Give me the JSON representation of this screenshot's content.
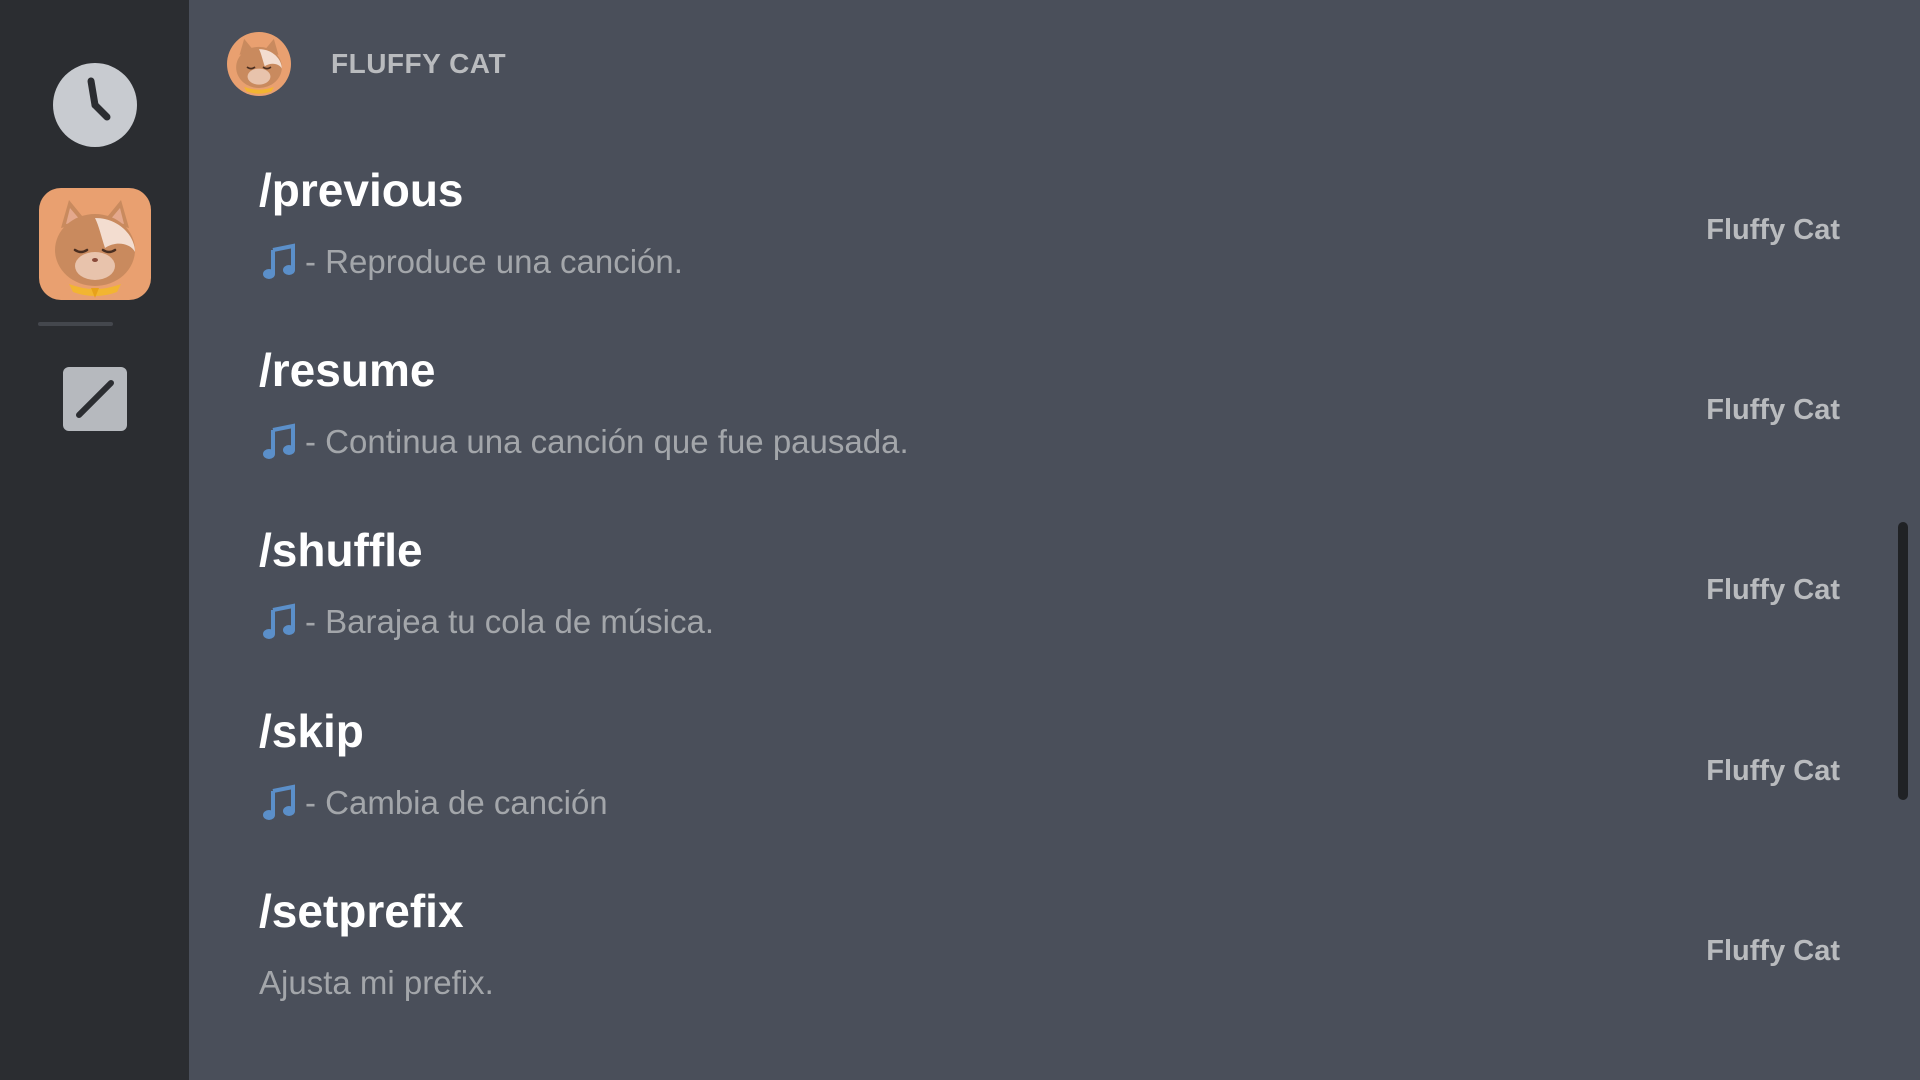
{
  "sidebar": {
    "items": [
      {
        "name": "recent",
        "icon": "clock-icon"
      },
      {
        "name": "bot",
        "icon": "fluffy-cat-avatar"
      },
      {
        "name": "built-in",
        "icon": "slash-icon"
      }
    ]
  },
  "section": {
    "title": "FLUFFY CAT"
  },
  "commands": [
    {
      "name": "/previous",
      "icon": "music-note-icon",
      "description": "- Reproduce una canción.",
      "source": "Fluffy Cat"
    },
    {
      "name": "/resume",
      "icon": "music-note-icon",
      "description": "- Continua una canción que fue pausada.",
      "source": "Fluffy Cat"
    },
    {
      "name": "/shuffle",
      "icon": "music-note-icon",
      "description": "- Barajea tu cola de música.",
      "source": "Fluffy Cat"
    },
    {
      "name": "/skip",
      "icon": "music-note-icon",
      "description": "- Cambia de canción",
      "source": "Fluffy Cat"
    },
    {
      "name": "/setprefix",
      "icon": "",
      "description": "Ajusta mi prefix.",
      "source": "Fluffy Cat"
    }
  ],
  "colors": {
    "background": "#4a4f5a",
    "sidebar": "#2b2d31",
    "note": "#5b8fc9"
  }
}
